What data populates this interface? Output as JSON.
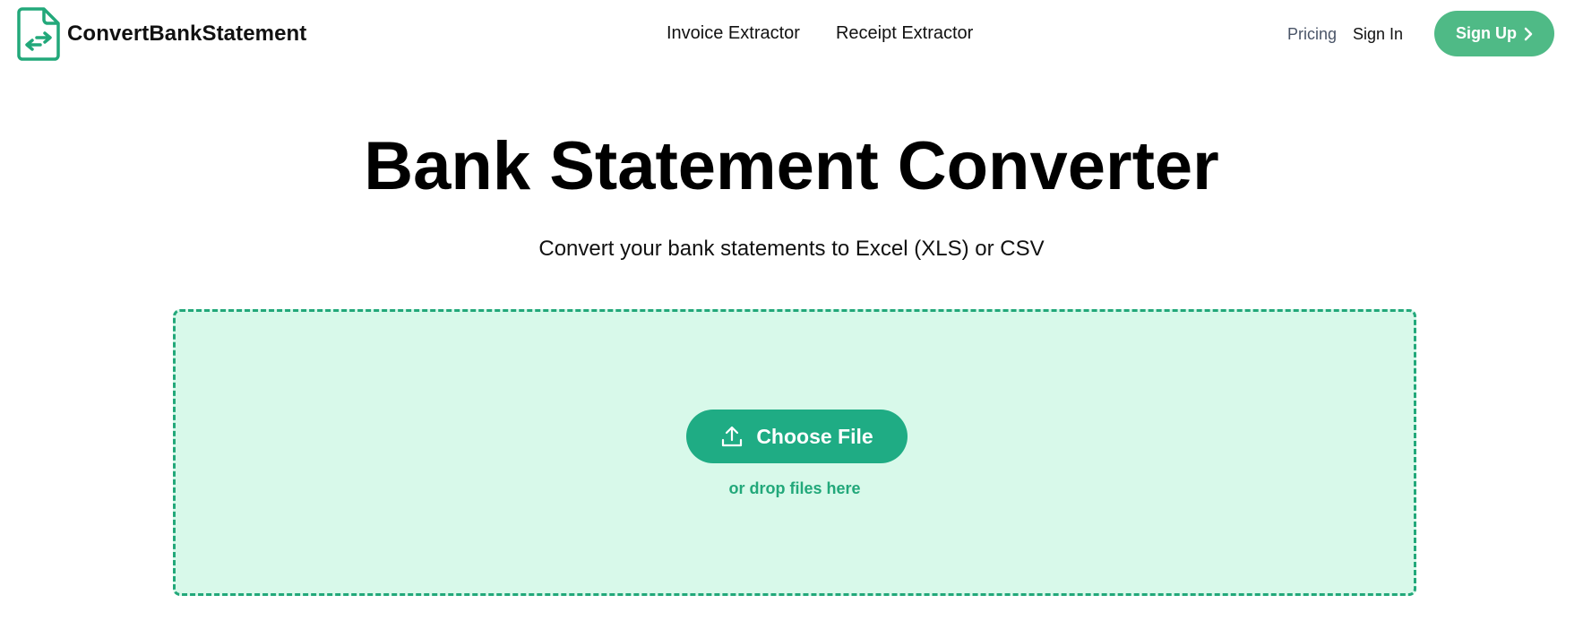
{
  "brand": {
    "name": "ConvertBankStatement",
    "color": "#22a87a"
  },
  "nav": {
    "center": [
      "Invoice Extractor",
      "Receipt Extractor"
    ],
    "pricing": "Pricing",
    "sign_in": "Sign In",
    "sign_up": "Sign Up",
    "sign_up_icon": "chevron-right-icon"
  },
  "hero": {
    "title": "Bank Statement Converter",
    "subtitle": "Convert your bank statements to Excel (XLS) or CSV"
  },
  "upload": {
    "button_label": "Choose File",
    "button_icon": "upload-icon",
    "drop_hint": "or drop files here",
    "zone_background": "#d8f9ea",
    "button_color": "#1fac84"
  }
}
